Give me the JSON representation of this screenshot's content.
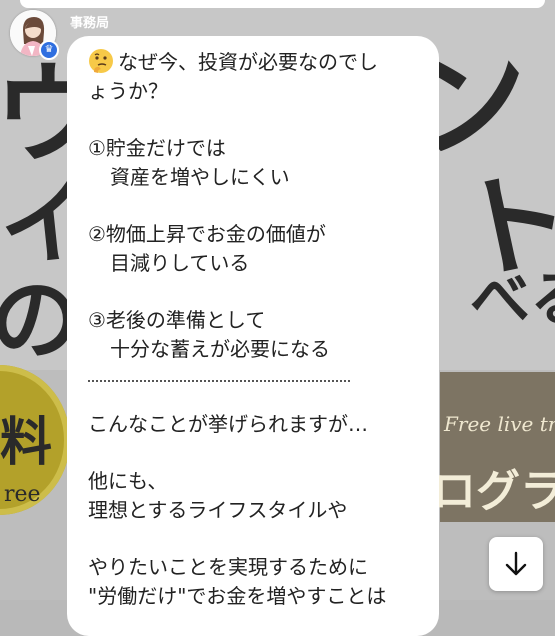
{
  "sender": {
    "name": "事務局"
  },
  "message": {
    "line_q1": "なぜ今、投資が必要なのでし",
    "line_q2": "ょうか？",
    "p1_a": "①貯金だけでは",
    "p1_b": "資産を増やしにくい",
    "p2_a": "②物価上昇でお金の価値が",
    "p2_b": "目減りしている",
    "p3_a": "③老後の準備として",
    "p3_b": "十分な蓄えが必要になる",
    "after_1": "こんなことが挙げられますが…",
    "after_2": "他にも、",
    "after_3": "理想とするライフスタイルや",
    "after_4": "やりたいことを実現するために",
    "after_5": "\"労働だけ\"でお金を増やすことは"
  },
  "background": {
    "glyph_1": "ウ",
    "glyph_2": "ン",
    "glyph_3": "イ",
    "glyph_4": "ト",
    "glyph_5": "の",
    "glyph_6": "べる",
    "seal_kanji": "料",
    "seal_text": "ree",
    "band_text_1": "Free live tre",
    "band_text_2": "ログラ"
  },
  "icons": {
    "emoji": "thinking-face",
    "scroll": "arrow-down-icon",
    "badge": "crown-icon"
  },
  "colors": {
    "bubble": "#ffffff",
    "badge": "#2f6fe0",
    "text": "#222222"
  }
}
